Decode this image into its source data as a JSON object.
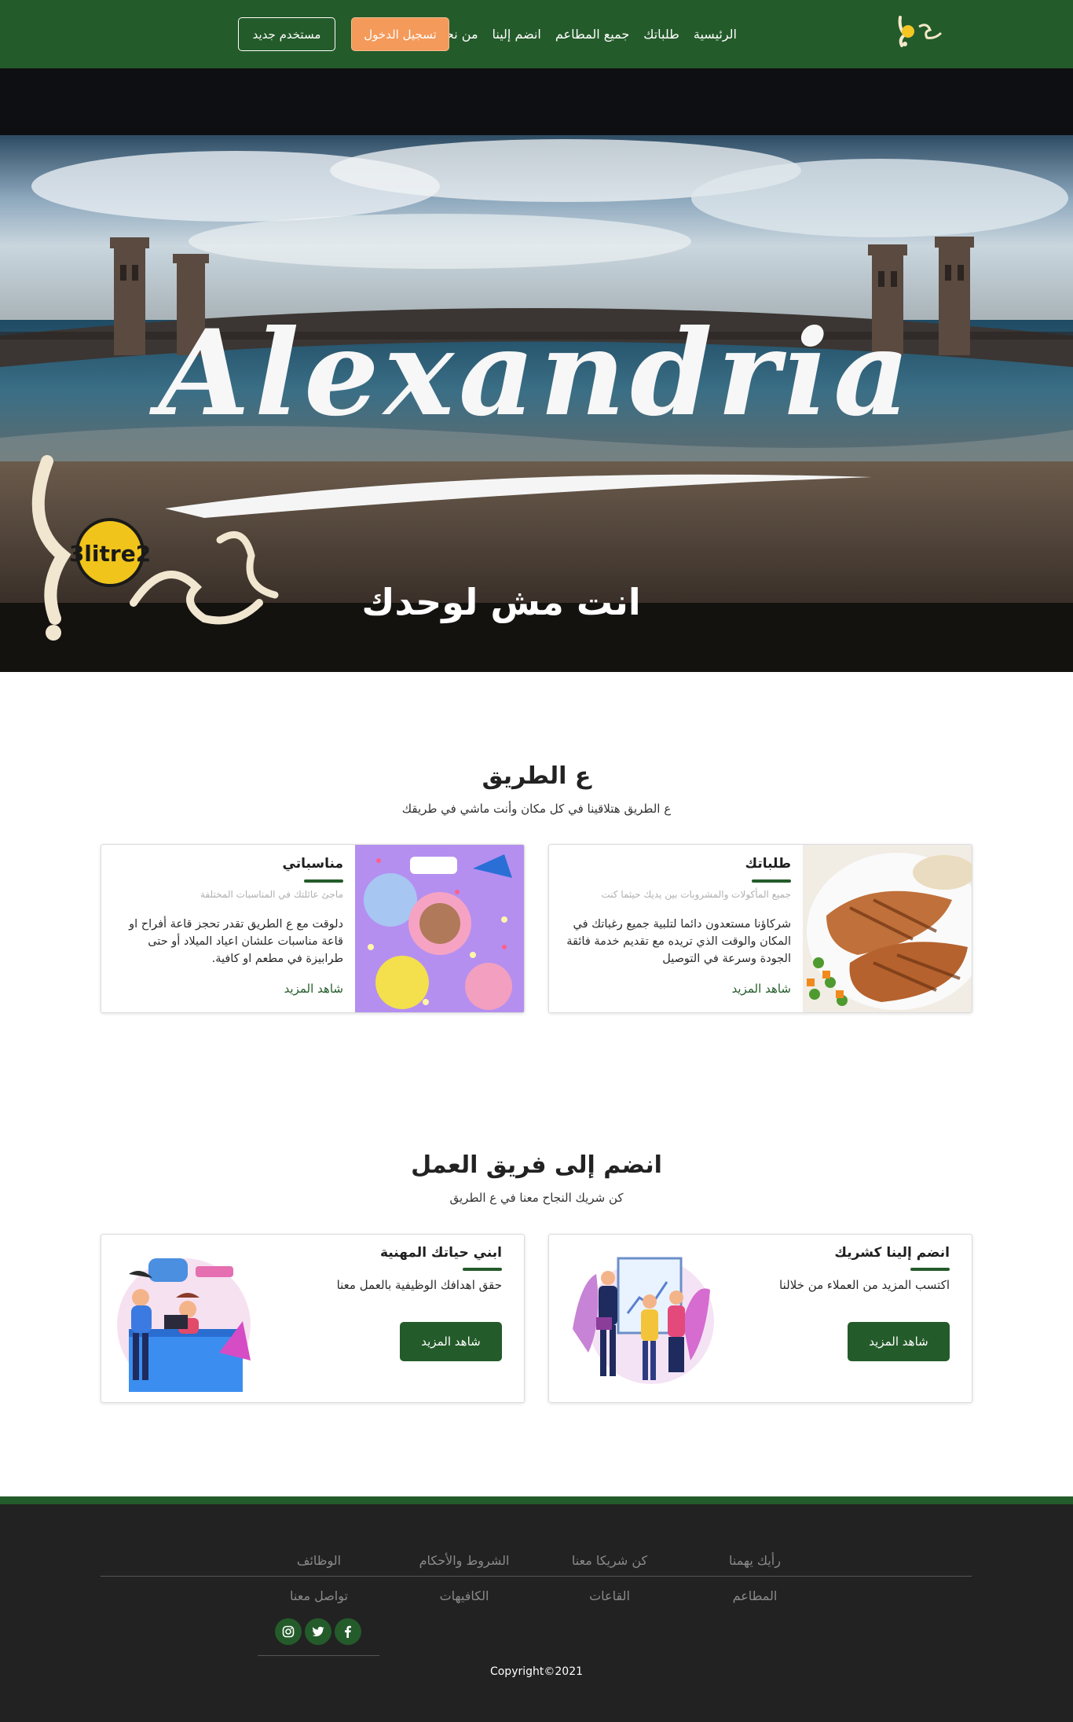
{
  "nav": {
    "links": [
      "الرئيسية",
      "طلباتك",
      "جميع المطاعم",
      "انضم إلينا",
      "من نحن"
    ],
    "login_label": "تسجيل الدخول",
    "register_label": "مستخدم جديد"
  },
  "hero": {
    "script_text": "Alexandria",
    "logo_badge": "3litre2",
    "tagline": "انت مش لوحدك"
  },
  "about": {
    "title": "ع الطريق",
    "subtitle": "ع الطريق هتلاقينا في كل مكان وأنت ماشي في طريقك",
    "cards": [
      {
        "title": "طلباتك",
        "small": "جميع المأكولات والمشروبات بين يديك حيثما كنت",
        "text": "شركاؤنا مستعدون دائما لتلبية جميع رغباتك في المكان والوقت الذي تريده مع تقديم خدمة فائقة الجودة وسرعة في التوصيل",
        "link": "شاهد المزيد"
      },
      {
        "title": "مناسباتي",
        "small": "ماجئ عائلتك في المناسبات المختلفة",
        "text": "دلوقت مع ع الطريق تقدر تحجز قاعة أفراح او قاعة مناسبات علشان اعياد الميلاد أو حتى طرابيزة في مطعم او كافية.",
        "link": "شاهد المزيد"
      }
    ]
  },
  "join": {
    "title": "انضم إلى فريق العمل",
    "subtitle": "كن شريك النجاح معنا في ع الطريق",
    "cards": [
      {
        "title": "انضم إلينا كشريك",
        "text": "اكتسب المزيد من العملاء من خلالنا",
        "button": "شاهد المزيد"
      },
      {
        "title": "ابني حياتك المهنية",
        "text": "حقق اهدافك الوظيفية بالعمل معنا",
        "button": "شاهد المزيد"
      }
    ]
  },
  "footer": {
    "row1": [
      "رأيك يهمنا",
      "كن شريكا معنا",
      "الشروط والأحكام",
      "الوظائف"
    ],
    "row2": [
      "المطاعم",
      "القاعات",
      "الكافيهات",
      "تواصل معنا"
    ],
    "social": [
      "facebook-icon",
      "twitter-icon",
      "instagram-icon"
    ],
    "copyright": "Copyright©2021"
  },
  "colors": {
    "brand": "#245b2a",
    "accent": "#f49a5a",
    "footer_bg": "#222222"
  }
}
